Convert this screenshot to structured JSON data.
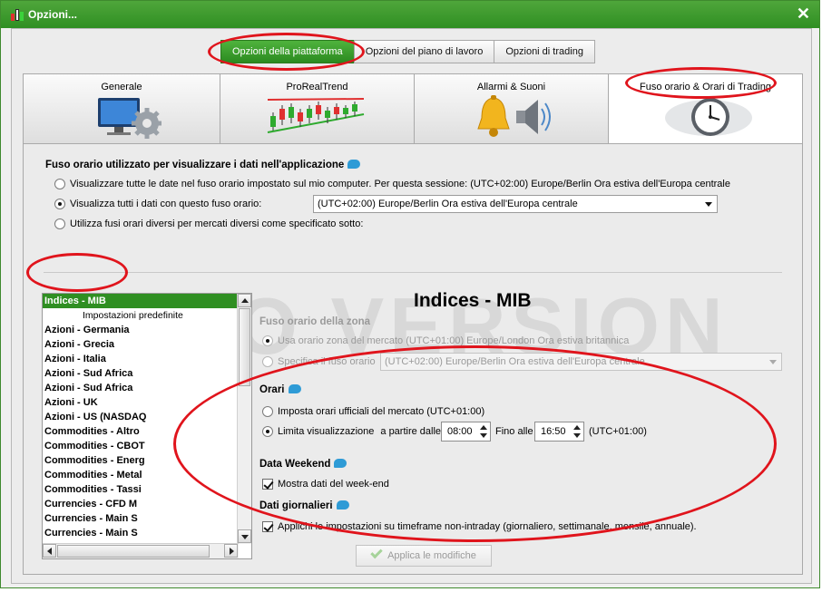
{
  "window": {
    "title": "Opzioni..."
  },
  "top_buttons": [
    {
      "label": "Opzioni della piattaforma",
      "active": true
    },
    {
      "label": "Opzioni del piano di lavoro",
      "active": false
    },
    {
      "label": "Opzioni di trading",
      "active": false
    }
  ],
  "tabs": [
    {
      "label": "Generale",
      "icon": "monitor-gear-icon"
    },
    {
      "label": "ProRealTrend",
      "icon": "candlestick-trend-icon"
    },
    {
      "label": "Allarmi & Suoni",
      "icon": "bell-speaker-icon"
    },
    {
      "label": "Fuso orario & Orari di Trading",
      "icon": "clock-globe-icon",
      "active": true
    }
  ],
  "timezone_section": {
    "title": "Fuso orario utilizzato per visualizzare i dati nell'applicazione",
    "option1": "Visualizzare tutte le date nel fuso orario impostato sul mio computer. Per questa sessione: (UTC+02:00) Europe/Berlin Ora estiva dell'Europa centrale",
    "option2": "Visualizza tutti i dati con questo fuso orario:",
    "option2_value": "(UTC+02:00) Europe/Berlin Ora estiva dell'Europa centrale",
    "option3": "Utilizza fusi orari diversi per mercati diversi come specificato sotto:",
    "selected": 2
  },
  "markets": [
    {
      "label": "Indices - MIB",
      "selected": true
    },
    {
      "label": "Impostazioni predefinite",
      "sub": true
    },
    {
      "label": "Azioni - Germania"
    },
    {
      "label": "Azioni - Grecia"
    },
    {
      "label": "Azioni - Italia"
    },
    {
      "label": "Azioni - Sud Africa"
    },
    {
      "label": "Azioni - Sud Africa"
    },
    {
      "label": "Azioni - UK"
    },
    {
      "label": "Azioni - US (NASDAQ"
    },
    {
      "label": "Commodities - Altro"
    },
    {
      "label": "Commodities - CBOT"
    },
    {
      "label": "Commodities - Energ"
    },
    {
      "label": "Commodities - Metal"
    },
    {
      "label": "Commodities - Tassi"
    },
    {
      "label": "Currencies - CFD M"
    },
    {
      "label": "Currencies - Main S"
    },
    {
      "label": "Currencies - Main S"
    }
  ],
  "detail": {
    "title": "Indices - MIB",
    "watermark": "DEMO VERSION",
    "zone_title": "Fuso orario della zona",
    "zone_opt1": "Usa orario zona del mercato (UTC+01:00) Europe/London Ora estiva britannica",
    "zone_opt2": "Specifica il fuso orario",
    "zone_opt2_value": "(UTC+02:00) Europe/Berlin Ora estiva dell'Europa centrale",
    "orari_title": "Orari",
    "orari_opt1": "Imposta orari ufficiali del mercato  (UTC+01:00)",
    "orari_opt2": "Limita visualizzazione",
    "from_label": "a partire dalle",
    "from_value": "08:00",
    "to_label": "Fino alle",
    "to_value": "16:50",
    "tz_suffix": "(UTC+01:00)",
    "weekend_title": "Data Weekend",
    "weekend_check": "Mostra dati del week-end",
    "daily_title": "Dati giornalieri",
    "daily_check": "Applichi le impostazioni su timeframe non-intraday (giornaliero, settimanale, mensile, annuale).",
    "apply_button": "Applica le modifiche"
  },
  "annotation_color": "#e0141c"
}
